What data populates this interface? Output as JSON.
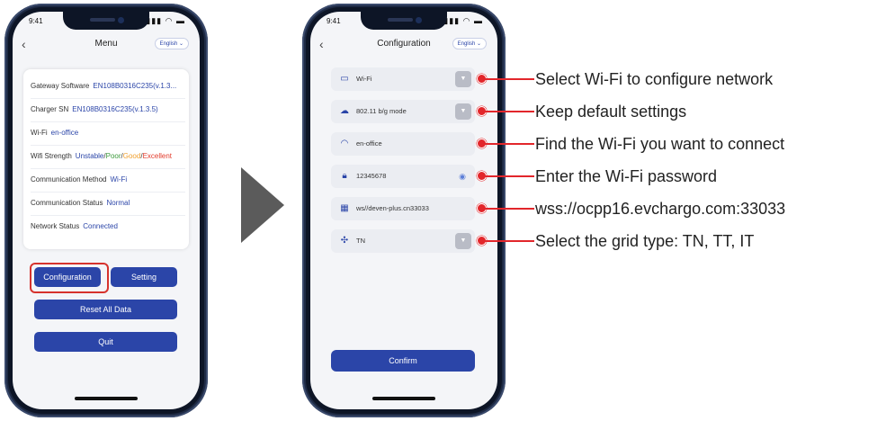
{
  "status": {
    "time": "9:41",
    "signal_icons": "signal-wifi-battery"
  },
  "menu_screen": {
    "title": "Menu",
    "language": "English",
    "info": [
      {
        "label": "Gateway Software",
        "value": "EN108B0316C235(v.1.3..."
      },
      {
        "label": "Charger SN",
        "value": "EN108B0316C235(v.1.3.5)"
      },
      {
        "label": "Wi-Fi",
        "value": "en-office"
      },
      {
        "label": "Wifi Strength",
        "value_parts": [
          "Unstable",
          "/",
          "Poor",
          "/",
          "Good",
          "/",
          "Excellent"
        ]
      },
      {
        "label": "Communication Method",
        "value": "Wi-Fi"
      },
      {
        "label": "Communication Status",
        "value": "Normal"
      },
      {
        "label": "Network Status",
        "value": "Connected"
      }
    ],
    "buttons": {
      "configuration": "Configuration",
      "setting": "Setting",
      "reset": "Reset All Data",
      "quit": "Quit"
    },
    "colors": {
      "accent": "#2b45a8",
      "highlight": "#d6332d",
      "unstable": "#2b45a8",
      "poor": "#3c9a3c",
      "good": "#f0a030",
      "excellent": "#e23a2a"
    }
  },
  "config_screen": {
    "title": "Configuration",
    "language": "English",
    "fields": [
      {
        "icon": "tablet-icon",
        "value": "Wi-Fi",
        "dropdown": true
      },
      {
        "icon": "wifi-mode-icon",
        "value": "802.11 b/g mode",
        "dropdown": true
      },
      {
        "icon": "wifi-icon",
        "value": "en-office",
        "dropdown": false
      },
      {
        "icon": "lock-icon",
        "value": "12345678",
        "dropdown": false,
        "eye": true
      },
      {
        "icon": "server-icon",
        "value": "ws//deven-plus.cn33033",
        "dropdown": false
      },
      {
        "icon": "grid-icon",
        "value": "TN",
        "dropdown": true
      }
    ],
    "confirm": "Confirm"
  },
  "callouts": [
    "Select Wi-Fi to configure network",
    "Keep default settings",
    "Find the Wi-Fi you want to connect",
    "Enter the Wi-Fi password",
    "wss://ocpp16.evchargo.com:33033",
    "Select the grid type: TN, TT, IT"
  ]
}
